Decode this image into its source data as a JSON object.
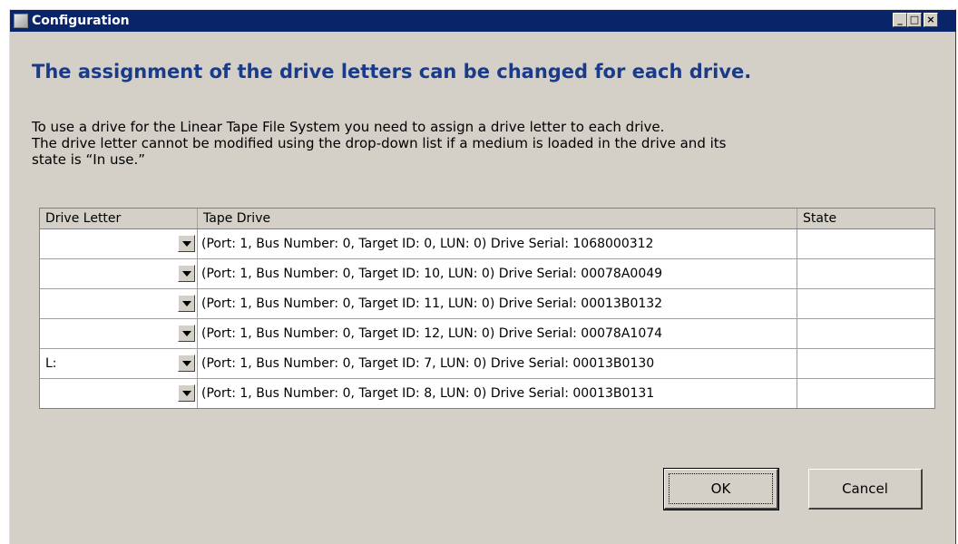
{
  "window": {
    "title": "Configuration",
    "controls": {
      "minimize": "_",
      "maximize": "□",
      "close": "×"
    }
  },
  "heading": "The assignment of the drive letters can be changed for each drive.",
  "description": {
    "line1": "To use a drive for the Linear Tape File System you need to assign a drive letter to each drive.",
    "line2": "The drive letter cannot be modified using the drop-down list if a medium is loaded in the drive and its",
    "line3": "state is “In use.”"
  },
  "table": {
    "headers": {
      "letter": "Drive Letter",
      "drive": "Tape Drive",
      "state": "State"
    },
    "rows": [
      {
        "letter": "",
        "drive": "(Port: 1, Bus Number: 0, Target ID: 0, LUN: 0) Drive Serial: 1068000312",
        "state": ""
      },
      {
        "letter": "",
        "drive": "(Port: 1, Bus Number: 0, Target ID: 10, LUN: 0) Drive Serial: 00078A0049",
        "state": ""
      },
      {
        "letter": "",
        "drive": "(Port: 1, Bus Number: 0, Target ID: 11, LUN: 0) Drive Serial: 00013B0132",
        "state": ""
      },
      {
        "letter": "",
        "drive": "(Port: 1, Bus Number: 0, Target ID: 12, LUN: 0) Drive Serial: 00078A1074",
        "state": ""
      },
      {
        "letter": "L:",
        "drive": "(Port: 1, Bus Number: 0, Target ID: 7, LUN: 0) Drive Serial: 00013B0130",
        "state": ""
      },
      {
        "letter": "",
        "drive": "(Port: 1, Bus Number: 0, Target ID: 8, LUN: 0) Drive Serial: 00013B0131",
        "state": ""
      }
    ]
  },
  "buttons": {
    "ok": "OK",
    "cancel": "Cancel"
  }
}
